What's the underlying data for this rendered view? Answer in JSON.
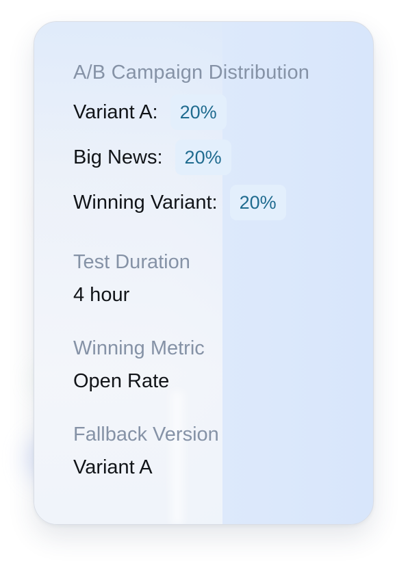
{
  "distribution": {
    "title": "A/B Campaign Distribution",
    "rows": [
      {
        "label": "Variant A:",
        "percent": "20%"
      },
      {
        "label": "Big News:",
        "percent": "20%"
      },
      {
        "label": "Winning Variant:",
        "percent": "20%"
      }
    ]
  },
  "test_duration": {
    "label": "Test Duration",
    "value": "4 hour"
  },
  "winning_metric": {
    "label": "Winning Metric",
    "value": "Open Rate"
  },
  "fallback_version": {
    "label": "Fallback Version",
    "value": "Variant A"
  },
  "colors": {
    "label_gray": "#8592a6",
    "text_dark": "#111418",
    "badge_bg": "#e3effc",
    "badge_text": "#1f6b8f",
    "card_blue": "#d8e6fb"
  }
}
